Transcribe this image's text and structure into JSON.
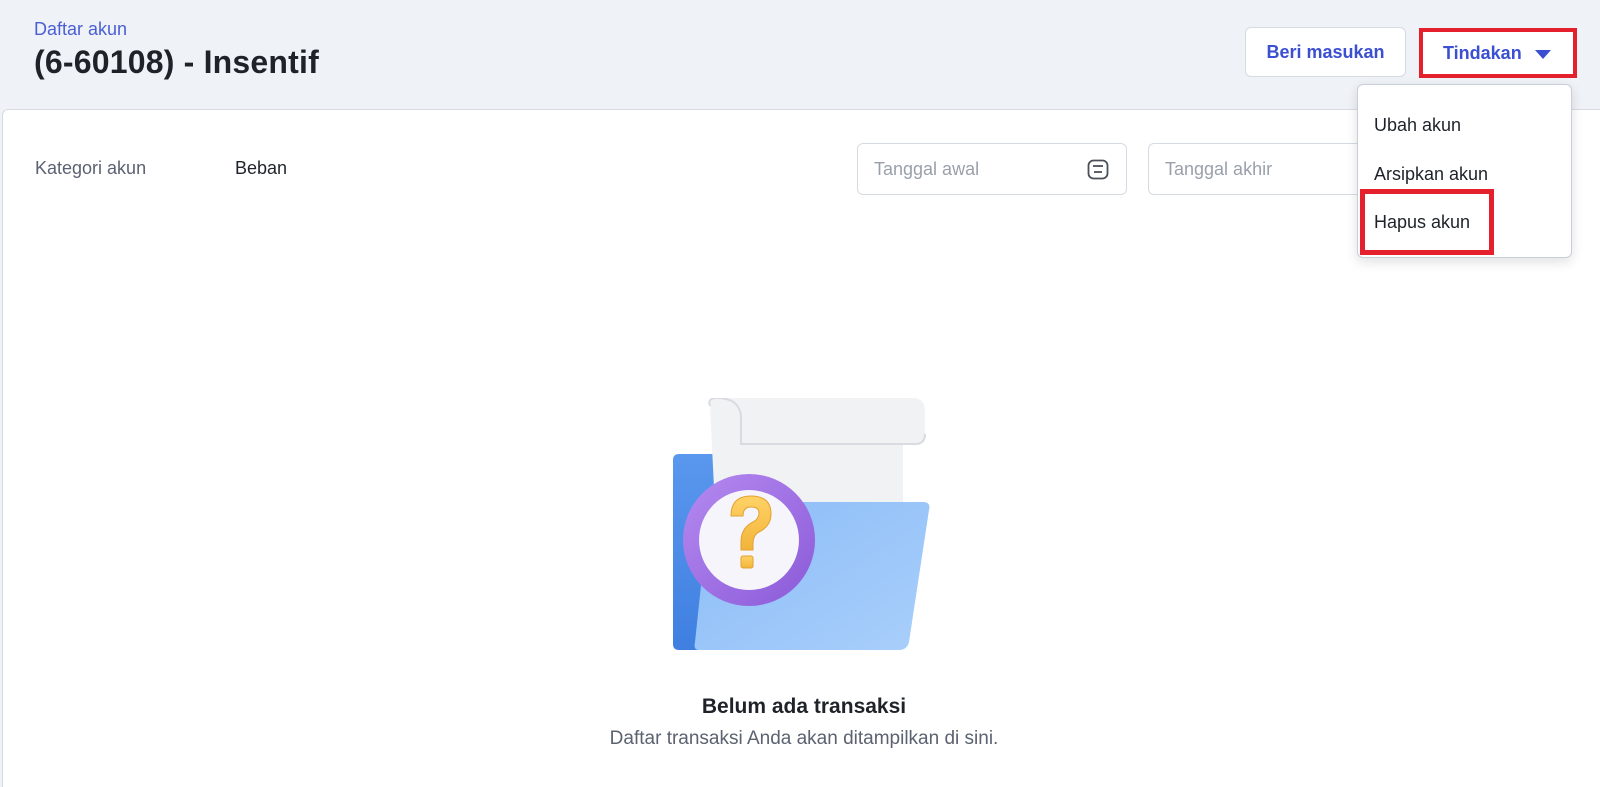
{
  "header": {
    "breadcrumb": "Daftar akun",
    "title": "(6-60108) - Insentif",
    "feedback_button": "Beri masukan",
    "actions_button": "Tindakan"
  },
  "details": {
    "category_label": "Kategori akun",
    "category_value": "Beban"
  },
  "filters": {
    "start_date_placeholder": "Tanggal awal",
    "end_date_placeholder": "Tanggal akhir"
  },
  "actions_menu": {
    "items": [
      "Ubah akun",
      "Arsipkan akun",
      "Hapus akun"
    ]
  },
  "empty_state": {
    "title": "Belum ada transaksi",
    "subtitle": "Daftar transaksi Anda akan ditampilkan di sini."
  },
  "colors": {
    "accent": "#3b4fd1",
    "highlight": "#e3202b",
    "background": "#eff2f7"
  },
  "icons": {
    "calendar": "calendar-icon",
    "caret": "caret-down-icon",
    "empty": "empty-folder-question-illustration"
  }
}
